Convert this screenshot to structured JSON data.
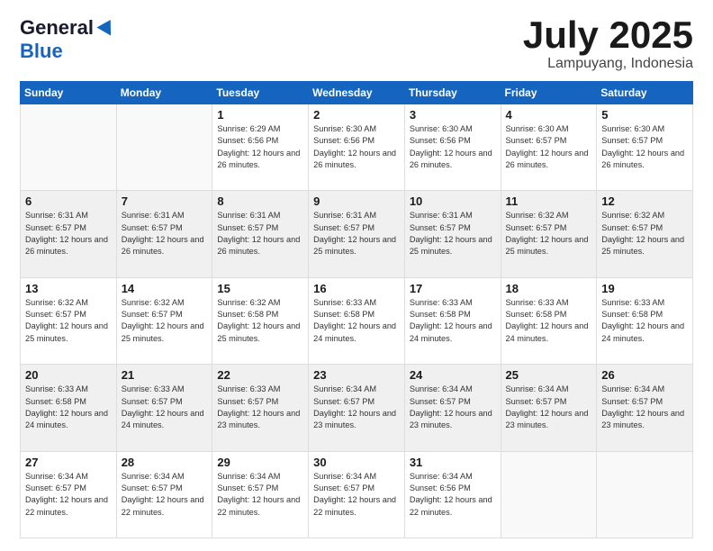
{
  "header": {
    "logo_general": "General",
    "logo_blue": "Blue",
    "month_title": "July 2025",
    "location": "Lampuyang, Indonesia"
  },
  "days_of_week": [
    "Sunday",
    "Monday",
    "Tuesday",
    "Wednesday",
    "Thursday",
    "Friday",
    "Saturday"
  ],
  "weeks": [
    [
      {
        "day": "",
        "empty": true
      },
      {
        "day": "",
        "empty": true
      },
      {
        "day": "1",
        "sunrise": "Sunrise: 6:29 AM",
        "sunset": "Sunset: 6:56 PM",
        "daylight": "Daylight: 12 hours and 26 minutes."
      },
      {
        "day": "2",
        "sunrise": "Sunrise: 6:30 AM",
        "sunset": "Sunset: 6:56 PM",
        "daylight": "Daylight: 12 hours and 26 minutes."
      },
      {
        "day": "3",
        "sunrise": "Sunrise: 6:30 AM",
        "sunset": "Sunset: 6:56 PM",
        "daylight": "Daylight: 12 hours and 26 minutes."
      },
      {
        "day": "4",
        "sunrise": "Sunrise: 6:30 AM",
        "sunset": "Sunset: 6:57 PM",
        "daylight": "Daylight: 12 hours and 26 minutes."
      },
      {
        "day": "5",
        "sunrise": "Sunrise: 6:30 AM",
        "sunset": "Sunset: 6:57 PM",
        "daylight": "Daylight: 12 hours and 26 minutes."
      }
    ],
    [
      {
        "day": "6",
        "sunrise": "Sunrise: 6:31 AM",
        "sunset": "Sunset: 6:57 PM",
        "daylight": "Daylight: 12 hours and 26 minutes."
      },
      {
        "day": "7",
        "sunrise": "Sunrise: 6:31 AM",
        "sunset": "Sunset: 6:57 PM",
        "daylight": "Daylight: 12 hours and 26 minutes."
      },
      {
        "day": "8",
        "sunrise": "Sunrise: 6:31 AM",
        "sunset": "Sunset: 6:57 PM",
        "daylight": "Daylight: 12 hours and 26 minutes."
      },
      {
        "day": "9",
        "sunrise": "Sunrise: 6:31 AM",
        "sunset": "Sunset: 6:57 PM",
        "daylight": "Daylight: 12 hours and 25 minutes."
      },
      {
        "day": "10",
        "sunrise": "Sunrise: 6:31 AM",
        "sunset": "Sunset: 6:57 PM",
        "daylight": "Daylight: 12 hours and 25 minutes."
      },
      {
        "day": "11",
        "sunrise": "Sunrise: 6:32 AM",
        "sunset": "Sunset: 6:57 PM",
        "daylight": "Daylight: 12 hours and 25 minutes."
      },
      {
        "day": "12",
        "sunrise": "Sunrise: 6:32 AM",
        "sunset": "Sunset: 6:57 PM",
        "daylight": "Daylight: 12 hours and 25 minutes."
      }
    ],
    [
      {
        "day": "13",
        "sunrise": "Sunrise: 6:32 AM",
        "sunset": "Sunset: 6:57 PM",
        "daylight": "Daylight: 12 hours and 25 minutes."
      },
      {
        "day": "14",
        "sunrise": "Sunrise: 6:32 AM",
        "sunset": "Sunset: 6:57 PM",
        "daylight": "Daylight: 12 hours and 25 minutes."
      },
      {
        "day": "15",
        "sunrise": "Sunrise: 6:32 AM",
        "sunset": "Sunset: 6:58 PM",
        "daylight": "Daylight: 12 hours and 25 minutes."
      },
      {
        "day": "16",
        "sunrise": "Sunrise: 6:33 AM",
        "sunset": "Sunset: 6:58 PM",
        "daylight": "Daylight: 12 hours and 24 minutes."
      },
      {
        "day": "17",
        "sunrise": "Sunrise: 6:33 AM",
        "sunset": "Sunset: 6:58 PM",
        "daylight": "Daylight: 12 hours and 24 minutes."
      },
      {
        "day": "18",
        "sunrise": "Sunrise: 6:33 AM",
        "sunset": "Sunset: 6:58 PM",
        "daylight": "Daylight: 12 hours and 24 minutes."
      },
      {
        "day": "19",
        "sunrise": "Sunrise: 6:33 AM",
        "sunset": "Sunset: 6:58 PM",
        "daylight": "Daylight: 12 hours and 24 minutes."
      }
    ],
    [
      {
        "day": "20",
        "sunrise": "Sunrise: 6:33 AM",
        "sunset": "Sunset: 6:58 PM",
        "daylight": "Daylight: 12 hours and 24 minutes."
      },
      {
        "day": "21",
        "sunrise": "Sunrise: 6:33 AM",
        "sunset": "Sunset: 6:57 PM",
        "daylight": "Daylight: 12 hours and 24 minutes."
      },
      {
        "day": "22",
        "sunrise": "Sunrise: 6:33 AM",
        "sunset": "Sunset: 6:57 PM",
        "daylight": "Daylight: 12 hours and 23 minutes."
      },
      {
        "day": "23",
        "sunrise": "Sunrise: 6:34 AM",
        "sunset": "Sunset: 6:57 PM",
        "daylight": "Daylight: 12 hours and 23 minutes."
      },
      {
        "day": "24",
        "sunrise": "Sunrise: 6:34 AM",
        "sunset": "Sunset: 6:57 PM",
        "daylight": "Daylight: 12 hours and 23 minutes."
      },
      {
        "day": "25",
        "sunrise": "Sunrise: 6:34 AM",
        "sunset": "Sunset: 6:57 PM",
        "daylight": "Daylight: 12 hours and 23 minutes."
      },
      {
        "day": "26",
        "sunrise": "Sunrise: 6:34 AM",
        "sunset": "Sunset: 6:57 PM",
        "daylight": "Daylight: 12 hours and 23 minutes."
      }
    ],
    [
      {
        "day": "27",
        "sunrise": "Sunrise: 6:34 AM",
        "sunset": "Sunset: 6:57 PM",
        "daylight": "Daylight: 12 hours and 22 minutes."
      },
      {
        "day": "28",
        "sunrise": "Sunrise: 6:34 AM",
        "sunset": "Sunset: 6:57 PM",
        "daylight": "Daylight: 12 hours and 22 minutes."
      },
      {
        "day": "29",
        "sunrise": "Sunrise: 6:34 AM",
        "sunset": "Sunset: 6:57 PM",
        "daylight": "Daylight: 12 hours and 22 minutes."
      },
      {
        "day": "30",
        "sunrise": "Sunrise: 6:34 AM",
        "sunset": "Sunset: 6:57 PM",
        "daylight": "Daylight: 12 hours and 22 minutes."
      },
      {
        "day": "31",
        "sunrise": "Sunrise: 6:34 AM",
        "sunset": "Sunset: 6:56 PM",
        "daylight": "Daylight: 12 hours and 22 minutes."
      },
      {
        "day": "",
        "empty": true
      },
      {
        "day": "",
        "empty": true
      }
    ]
  ]
}
